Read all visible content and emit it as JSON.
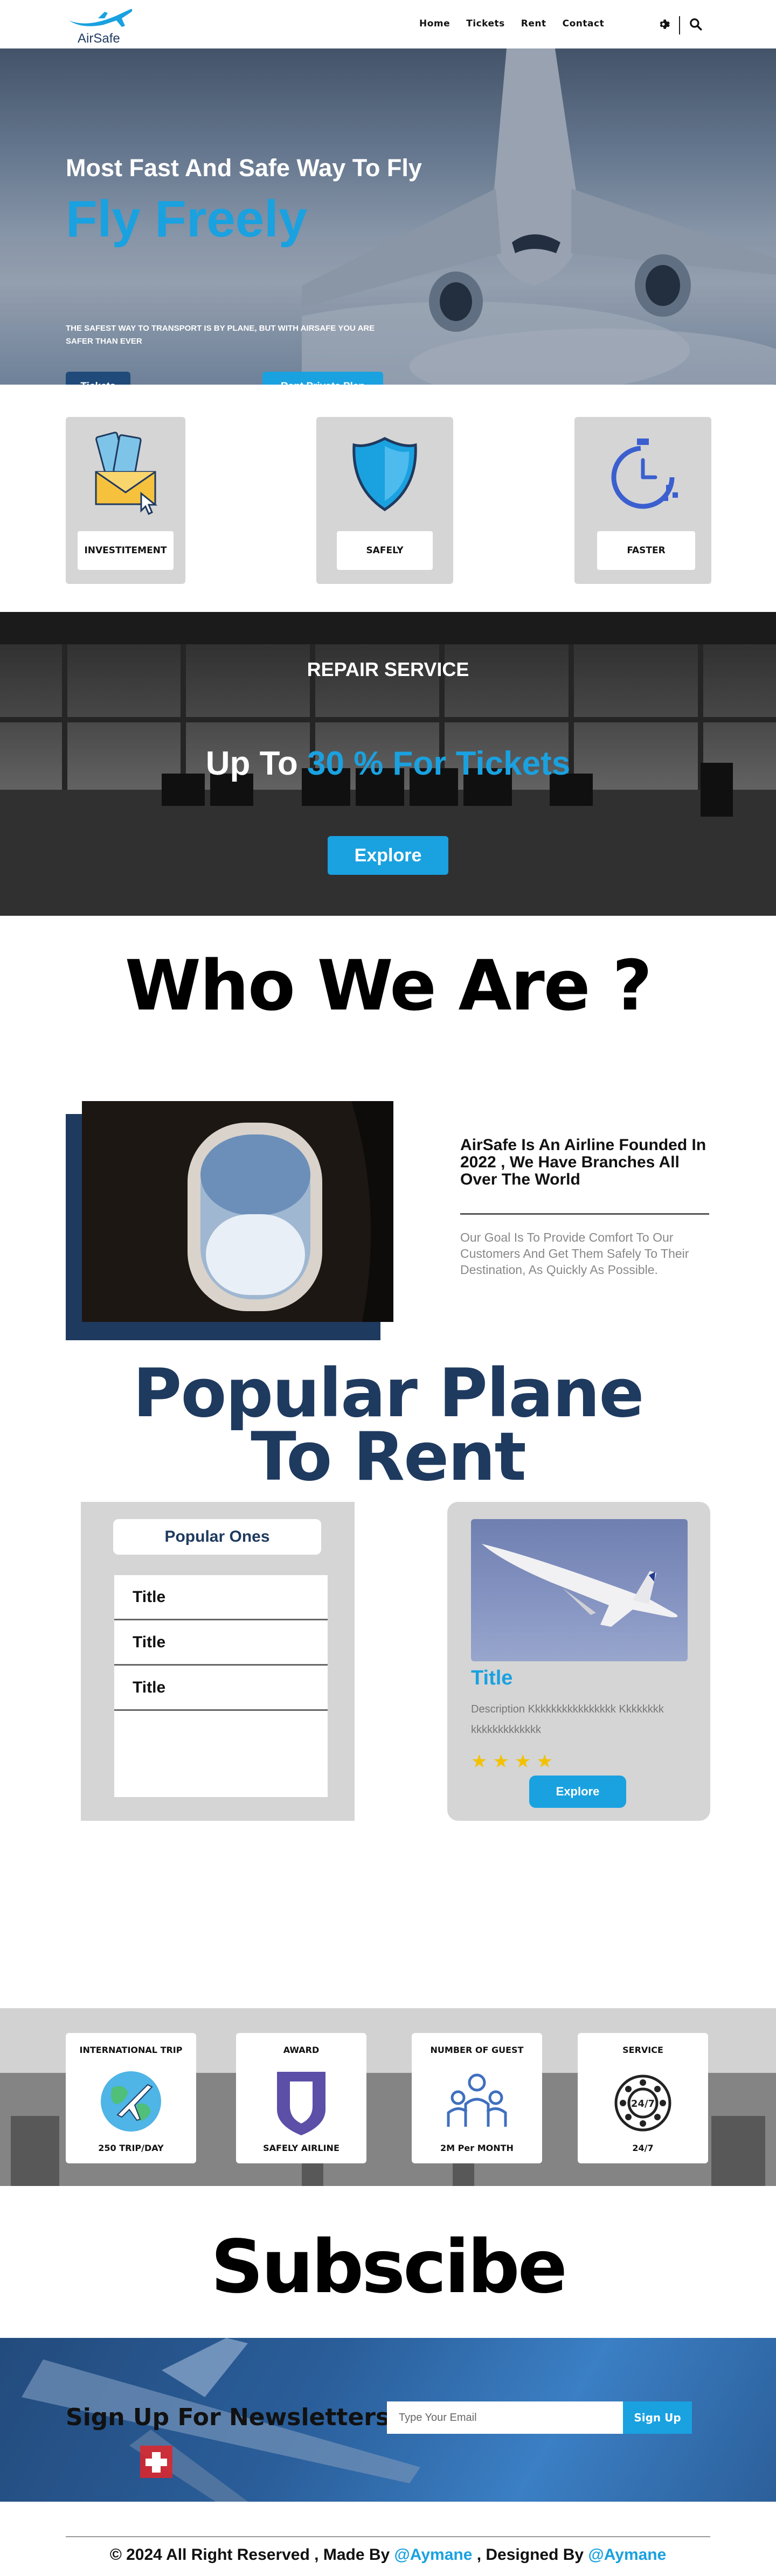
{
  "brand": {
    "name": "AirSafe",
    "accent": "#1aa1e0",
    "navy": "#1f3a5f"
  },
  "nav": {
    "links": [
      "Home",
      "Tickets",
      "Rent",
      "Contact"
    ],
    "icons": [
      "gear-icon",
      "search-icon"
    ]
  },
  "hero": {
    "subtitle": "Most Fast And Safe Way To Fly",
    "title": "Fly Freely",
    "description": "The safest way to transport is by plane, but with AirSafe you are safer than ever",
    "tickets_button": "Tickets",
    "rent_button": "Rent Private Plan"
  },
  "features": [
    {
      "label": "INVESTITEMENT",
      "icon": "money-envelope-icon"
    },
    {
      "label": "SAFELY",
      "icon": "shield-icon"
    },
    {
      "label": "FASTER",
      "icon": "stopwatch-icon"
    }
  ],
  "repair": {
    "title": "REPAIR SERVICE",
    "headline_prefix": "Up To ",
    "headline_accent": "30 % For Tickets",
    "button": "Explore"
  },
  "who": {
    "title": "Who We Are ?",
    "heading": "AirSafe Is An Airline Founded In 2022 , We Have Branches All Over The World",
    "description": "Our Goal Is To Provide Comfort To Our Customers And Get Them Safely To Their Destination, As Quickly As Possible."
  },
  "popular": {
    "title_line1": "Popular Plane",
    "title_line2": "To Rent",
    "list_header": "Popular Ones",
    "items": [
      "Title",
      "Title",
      "Title"
    ],
    "card": {
      "title": "Title",
      "description": "Description Kkkkkkkkkkkkkkkk Kkkkkkkkkkkkkkkkkkkkk",
      "rating": 4,
      "button": "Explore"
    }
  },
  "stats": [
    {
      "title": "INTERNATIONAL TRIP",
      "value": "250 TRIP/DAY",
      "icon": "globe-plane-icon"
    },
    {
      "title": "AWARD",
      "value": "SAFELY AIRLINE",
      "icon": "award-badge-icon"
    },
    {
      "title": "NUMBER OF GUEST",
      "value": "2M Per MONTH",
      "icon": "people-group-icon"
    },
    {
      "title": "SERVICE",
      "value": "24/7",
      "icon": "phone-24-7-icon"
    }
  ],
  "subscribe": {
    "title": "Subscibe"
  },
  "newsletter": {
    "title": "Sign Up For Newsletters",
    "placeholder": "Type Your Email",
    "button": "Sign Up"
  },
  "footer": {
    "prefix": "© 2024 All Right Reserved , Made By ",
    "made_by": "@Aymane",
    "middle": " , Designed By ",
    "designed_by": "@Aymane"
  }
}
